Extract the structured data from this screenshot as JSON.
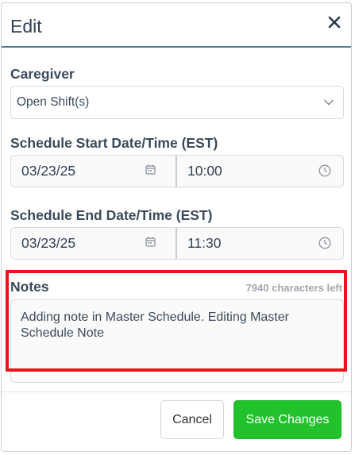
{
  "modal": {
    "title": "Edit",
    "close_icon": "close-icon"
  },
  "caregiver": {
    "label": "Caregiver",
    "value": "Open Shift(s)",
    "chevron_icon": "chevron-down-icon"
  },
  "start": {
    "label": "Schedule Start Date/Time (EST)",
    "date": "03/23/25",
    "time": "10:00",
    "date_icon": "calendar-icon",
    "time_icon": "clock-icon"
  },
  "end": {
    "label": "Schedule End Date/Time (EST)",
    "date": "03/23/25",
    "time": "11:30",
    "date_icon": "calendar-icon",
    "time_icon": "clock-icon"
  },
  "notes": {
    "label": "Notes",
    "chars_left": "7940 characters left",
    "value": "Adding note in Master Schedule. Editing Master Schedule Note"
  },
  "footer": {
    "cancel_label": "Cancel",
    "save_label": "Save Changes"
  },
  "colors": {
    "accent_save": "#21c22b",
    "header_underline": "#4f7a96",
    "highlight": "#e3161b"
  }
}
